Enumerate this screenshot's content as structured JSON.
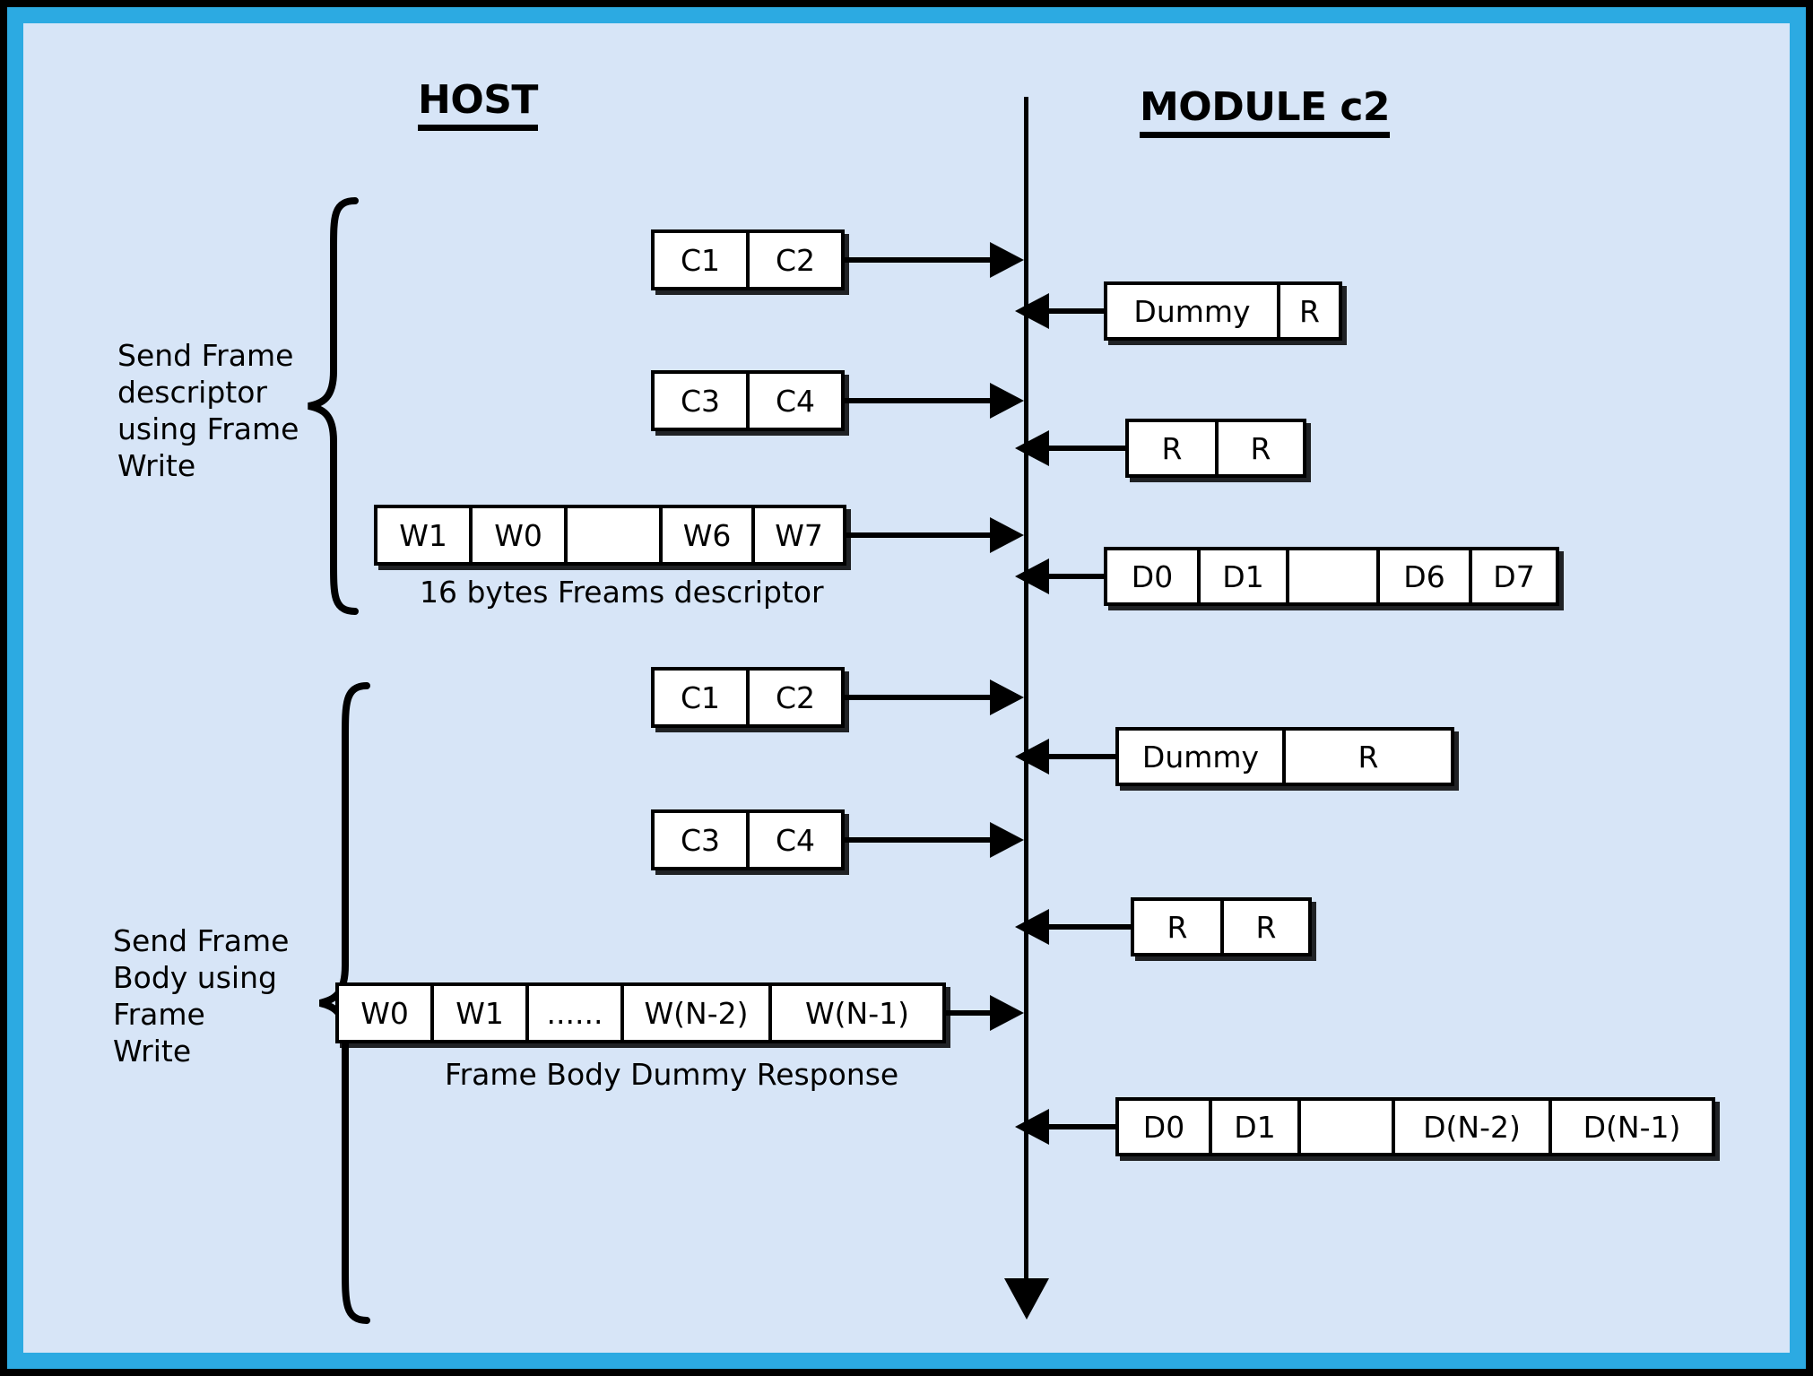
{
  "theme": {
    "outer_border": "#000000",
    "frame_accent": "#2CAAE2",
    "canvas_bg": "#D7E5F7",
    "line_color": "#000000",
    "box_fill": "#FFFFFF"
  },
  "lanes": {
    "host_title": "HOST",
    "module_title": "MODULE c2"
  },
  "groups": [
    {
      "label": "Send Frame\ndescriptor\nusing Frame\nWrite"
    },
    {
      "label": "Send Frame\nBody using\nFrame\nWrite"
    }
  ],
  "captions": [
    {
      "text": "16 bytes Freams descriptor"
    },
    {
      "text": "Frame Body Dummy Response"
    }
  ],
  "messages": [
    {
      "id": "m1",
      "direction": "host-to-module",
      "cells": [
        "C1",
        "C2"
      ]
    },
    {
      "id": "m2",
      "direction": "module-to-host",
      "cells": [
        "Dummy",
        "R"
      ]
    },
    {
      "id": "m3",
      "direction": "host-to-module",
      "cells": [
        "C3",
        "C4"
      ]
    },
    {
      "id": "m4",
      "direction": "module-to-host",
      "cells": [
        "R",
        "R"
      ]
    },
    {
      "id": "m5",
      "direction": "host-to-module",
      "cells": [
        "W1",
        "W0",
        "",
        "W6",
        "W7"
      ]
    },
    {
      "id": "m6",
      "direction": "module-to-host",
      "cells": [
        "D0",
        "D1",
        "",
        "D6",
        "D7"
      ]
    },
    {
      "id": "m7",
      "direction": "host-to-module",
      "cells": [
        "C1",
        "C2"
      ]
    },
    {
      "id": "m8",
      "direction": "module-to-host",
      "cells": [
        "Dummy",
        "R"
      ]
    },
    {
      "id": "m9",
      "direction": "host-to-module",
      "cells": [
        "C3",
        "C4"
      ]
    },
    {
      "id": "m10",
      "direction": "module-to-host",
      "cells": [
        "R",
        "R"
      ]
    },
    {
      "id": "m11",
      "direction": "host-to-module",
      "cells": [
        "W0",
        "W1",
        "......",
        "W(N-2)",
        "W(N-1)"
      ]
    },
    {
      "id": "m12",
      "direction": "module-to-host",
      "cells": [
        "D0",
        "D1",
        "",
        "D(N-2)",
        "D(N-1)"
      ]
    }
  ]
}
